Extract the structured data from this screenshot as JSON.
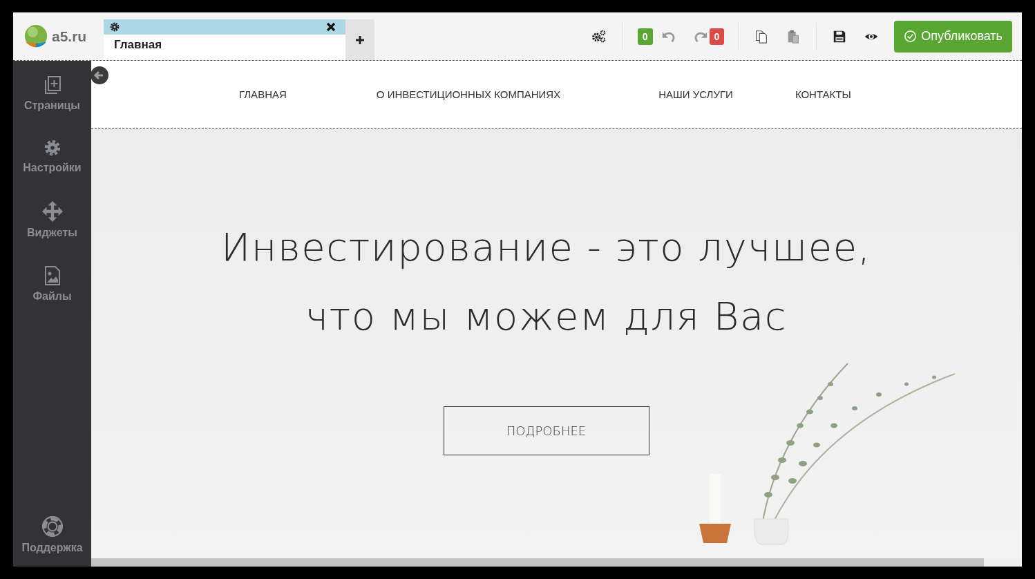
{
  "logo": {
    "text": "a5.ru"
  },
  "page_tabs": [
    {
      "label": "Главная",
      "selected": true
    }
  ],
  "toolbar": {
    "undo_count": "0",
    "redo_count": "0",
    "publish_label": "Опубликовать"
  },
  "sidebar": {
    "items": [
      {
        "label": "Страницы",
        "kind": "pages"
      },
      {
        "label": "Настройки",
        "kind": "settings"
      },
      {
        "label": "Виджеты",
        "kind": "widgets"
      },
      {
        "label": "Файлы",
        "kind": "files"
      }
    ],
    "support": {
      "label": "Поддержка"
    }
  },
  "site": {
    "nav": [
      "ГЛАВНАЯ",
      "О ИНВЕСТИЦИОННЫХ КОМПАНИЯХ",
      "НАШИ УСЛУГИ",
      "КОНТАКТЫ"
    ],
    "hero": {
      "title_lines": [
        "Инвестирование - это лучшее,",
        "что мы можем для Вас"
      ],
      "button": "ПОДРОБНЕЕ"
    }
  }
}
